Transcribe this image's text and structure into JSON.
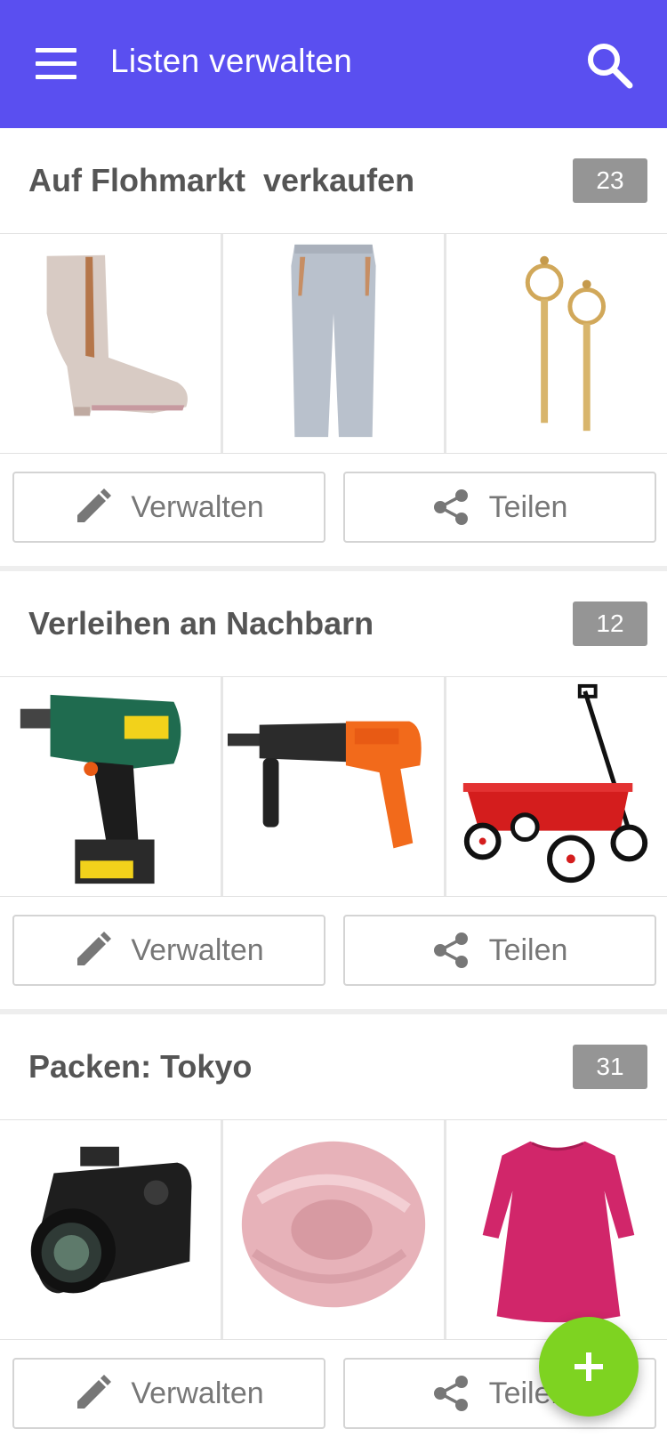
{
  "app_bar": {
    "title": "Listen verwalten",
    "color": "#5a4ff0",
    "menu_icon": "hamburger-menu-icon",
    "search_icon": "search-icon"
  },
  "lists": [
    {
      "title": "Auf Flohmarkt  verkaufen",
      "count": "23",
      "items": [
        "ankle-boot",
        "grey-trousers",
        "gold-earrings"
      ],
      "manage_label": "Verwalten",
      "share_label": "Teilen"
    },
    {
      "title": "Verleihen an Nachbarn",
      "count": "12",
      "items": [
        "cordless-drill",
        "hammer-drill",
        "red-wagon"
      ],
      "manage_label": "Verwalten",
      "share_label": "Teilen"
    },
    {
      "title": "Packen: Tokyo",
      "count": "31",
      "items": [
        "camera",
        "pink-scarf",
        "pink-dress"
      ],
      "manage_label": "Verwalten",
      "share_label": "Teilen"
    }
  ],
  "fab": {
    "icon": "plus-icon",
    "color": "#7ed321"
  }
}
